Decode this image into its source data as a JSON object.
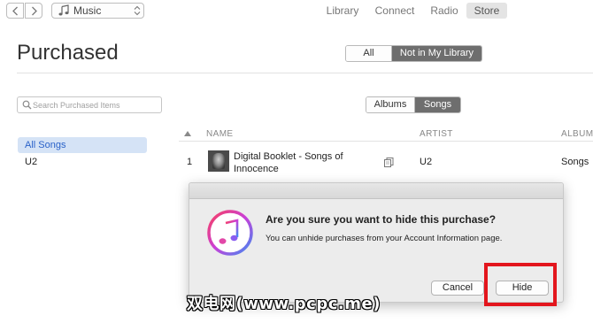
{
  "toolbar": {
    "back_icon": "chevron-left-icon",
    "forward_icon": "chevron-right-icon",
    "media_kind": "Music",
    "media_icon": "music-note-icon",
    "tabs": [
      {
        "label": "Library"
      },
      {
        "label": "Connect"
      },
      {
        "label": "Radio"
      },
      {
        "label": "Store",
        "selected": true
      }
    ]
  },
  "page": {
    "title": "Purchased",
    "filter_tabs": [
      {
        "label": "All",
        "selected": false
      },
      {
        "label": "Not in My Library",
        "selected": true
      }
    ],
    "type_tabs": [
      {
        "label": "Albums",
        "selected": false
      },
      {
        "label": "Songs",
        "selected": true
      }
    ]
  },
  "sidebar": {
    "search_placeholder": "Search Purchased Items",
    "items": [
      {
        "label": "All Songs",
        "selected": true
      },
      {
        "label": "U2",
        "selected": false
      }
    ]
  },
  "table": {
    "sort_icon": "sort-up-arrow-icon",
    "columns": {
      "name": "NAME",
      "artist": "ARTIST",
      "album": "ALBUM"
    },
    "rows": [
      {
        "num": "1",
        "name": "Digital Booklet - Songs of Innocence",
        "artist": "U2",
        "album": "Songs",
        "type_icon": "booklet-icon"
      }
    ]
  },
  "dialog": {
    "icon": "itunes-icon",
    "heading": "Are you sure you want to hide this purchase?",
    "message": "You can unhide purchases from your Account Information page.",
    "cancel_label": "Cancel",
    "hide_label": "Hide",
    "highlight_color": "#e3161d"
  },
  "watermark": "双电网(www.pcpc.me)",
  "colors": {
    "accent_selected": "#2a62c9",
    "segment_on": "#6e6e6e"
  }
}
